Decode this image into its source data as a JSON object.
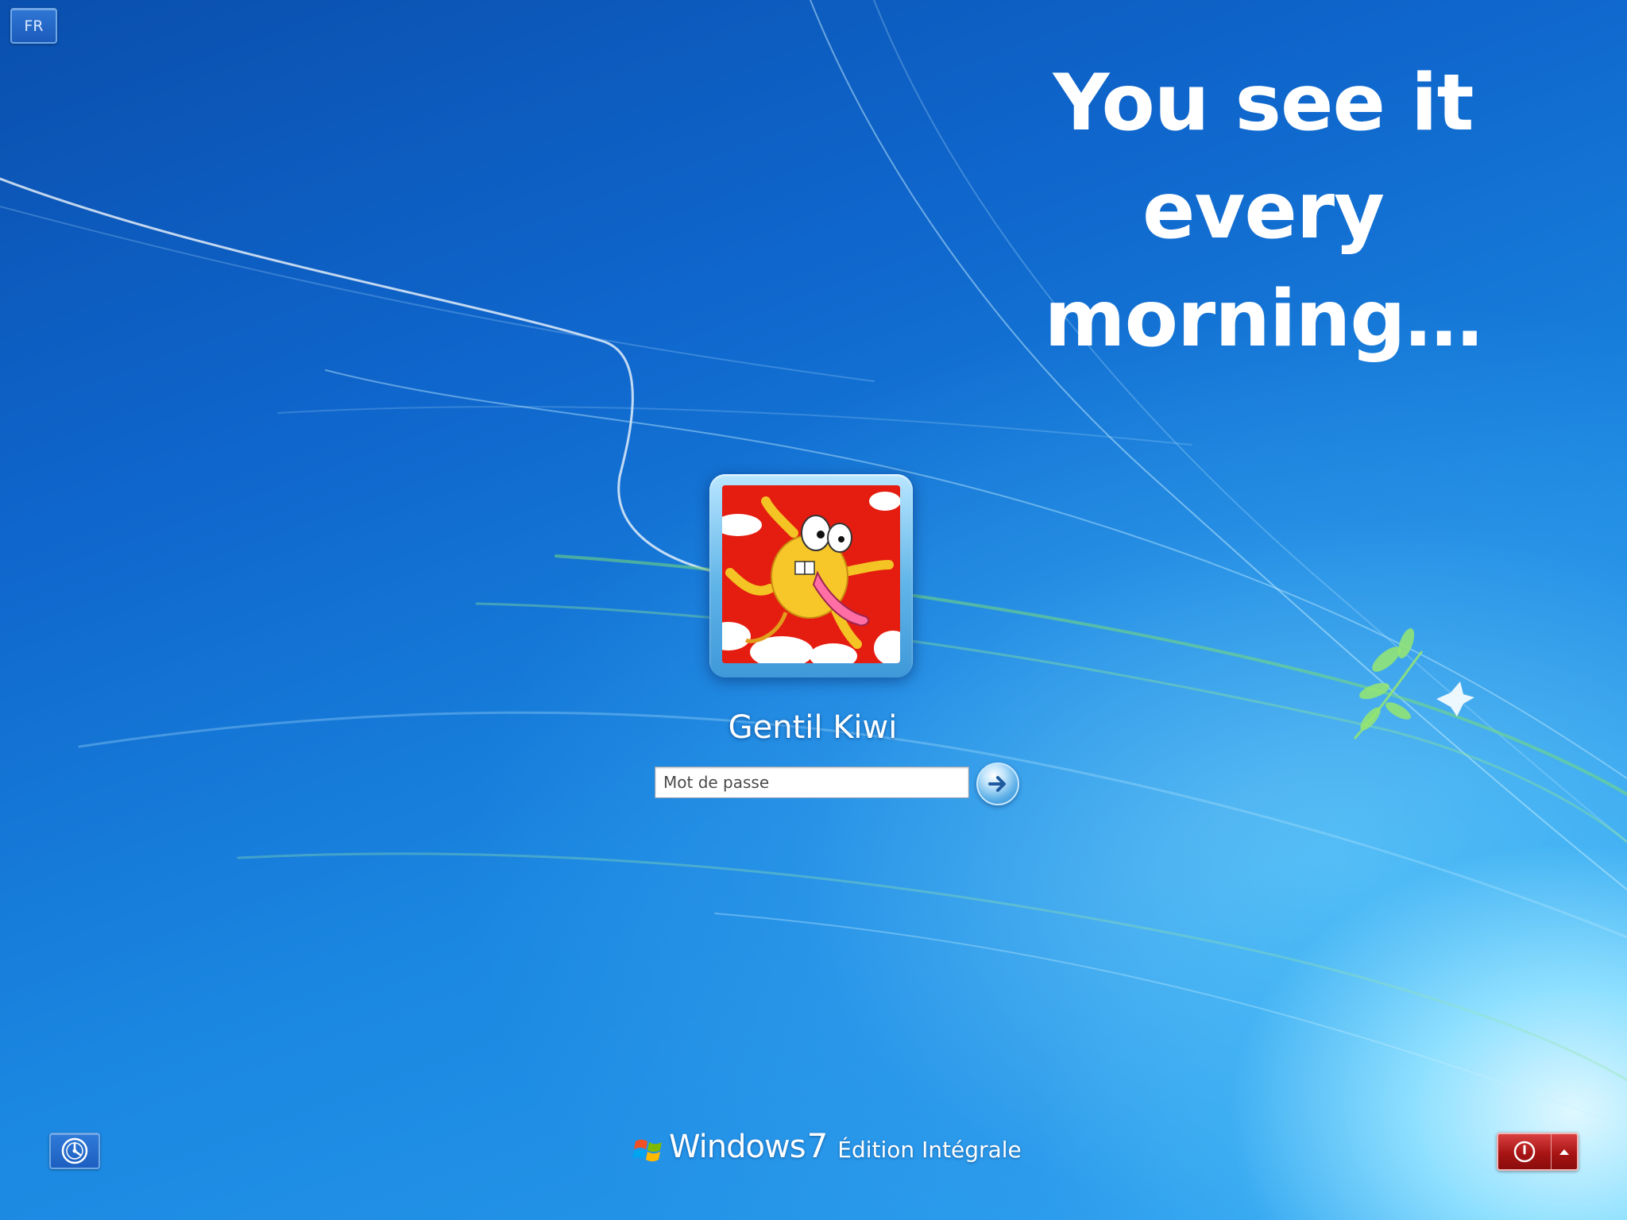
{
  "slide": {
    "headline": "You see it every morning…"
  },
  "top_bar": {
    "language_label": "FR"
  },
  "logon": {
    "user_name": "Gentil Kiwi",
    "password_placeholder": "Mot de passe",
    "password_value": "",
    "submit_icon": "arrow-right-icon"
  },
  "bottom_bar": {
    "ease_of_access_icon": "ease-of-access-icon",
    "branding": {
      "name": "Windows",
      "version": "7",
      "edition": "Édition Intégrale"
    },
    "power_icon": "power-icon",
    "power_options_icon": "triangle-up-icon"
  },
  "colors": {
    "background_deep": "#0a4fae",
    "background_light": "#8fe0ff",
    "power_red": "#a81414",
    "avatar_red": "#e41d10"
  }
}
